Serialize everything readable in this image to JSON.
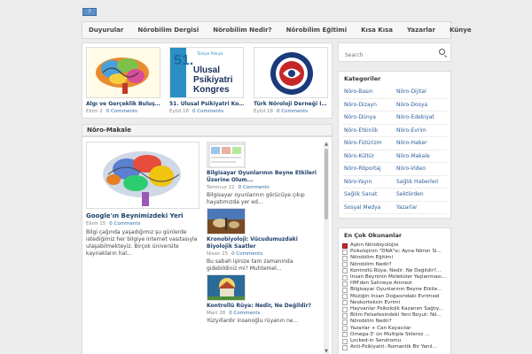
{
  "colors": {
    "accent": "#1d3f6a",
    "link": "#2e6aa8",
    "background": "#ececec"
  },
  "topbar": {
    "badge": "?"
  },
  "nav": [
    "Duyurular",
    "Nörobilim Dergisi",
    "Nörobilim Nedir?",
    "Nörobilim Eğitimi",
    "Kısa Kısa",
    "Yazarlar",
    "Künye"
  ],
  "featured": [
    {
      "title": "Algı ve Gerçeklik Buluşma...",
      "date": "Ekim 2",
      "comments": "0 Comments",
      "thumb_icon": "colorful-brain-image"
    },
    {
      "title": "51. Ulusal Psikiyatri Kon...",
      "date": "Eylül 18",
      "comments": "0 Comments",
      "thumb_text_small": "Türkiye Psikiya",
      "thumb_num": "51.",
      "thumb_line1": "Ulusal",
      "thumb_line2": "Psikiyatri",
      "thumb_line3": "Kongres"
    },
    {
      "title": "Türk Nöroloji Derneği İyi...",
      "date": "Eylül 18",
      "comments": "0 Comments",
      "thumb_icon": "neurology-society-logo"
    }
  ],
  "section_title": "Nöro-Makale",
  "big_post": {
    "title": "Google'ın Beynimizdeki Yeri",
    "date": "Ekim 15",
    "comments": "0 Comments",
    "excerpt": "Bilgi çağında yaşadığımız şu günlerde istediğimiz her bilgiye internet vasıtasıyla ulaşabilmekteyiz. Birçok üniversite kaynakların hal..."
  },
  "side_posts": [
    {
      "title": "Bilgisayar Oyunlarının Beyne Etkileri Üzerine Olum...",
      "date": "Temmuz 22",
      "comments": "0 Comments",
      "excerpt": "Bilgisayar oyunlarının görücüye çıkıp hayatımızda yer ed..."
    },
    {
      "title": "Kronobiyoloji: Vücudumuzdaki Biyolojik Saatler",
      "date": "Nisan 25",
      "comments": "0 Comments",
      "excerpt": "Bu sabah işinize tam zamanında gidebildiniz mi? Muhtemel..."
    },
    {
      "title": "Kontrollü Rüya: Nedir, Ne Değildir?",
      "date": "Mart 28",
      "comments": "0 Comments",
      "excerpt": "Yüzyıllardır insanoğlu rüyanın ne..."
    }
  ],
  "search": {
    "placeholder": "Search"
  },
  "categories": {
    "title": "Kategoriler",
    "items": [
      "Nöro-Basın",
      "Nöro-Dijital",
      "Nöro-Dizayn",
      "Nöro-Dosya",
      "Nöro-Dünya",
      "Nöro-Edebiyat",
      "Nöro-Etkinlik",
      "Nöro-Evrim",
      "Nöro-Fütürizm",
      "Nöro-Haber",
      "Nöro-Kültür",
      "Nöro-Makale",
      "Nöro-Röportaj",
      "Nöro-Video",
      "Nöro-Yayın",
      "Sağlık Haberleri",
      "Sağlık Sanat",
      "Sektörden",
      "Sosyal Medya",
      "Yazarlar"
    ]
  },
  "most_read": {
    "title": "En Çok Okunanlar",
    "items": [
      {
        "text": "Aşkın Nörobiyolojisi",
        "icon": "red"
      },
      {
        "text": "Psikolojinin \"DNA\"sı: Ayna Nöron Si...",
        "icon": "plain"
      },
      {
        "text": "Nörobilim Eğitimi",
        "icon": "plain"
      },
      {
        "text": "Nörobilim Nedir?",
        "icon": "plain"
      },
      {
        "text": "Kontrollü Rüya: Nedir, Ne Değildir?...",
        "icon": "plain"
      },
      {
        "text": "İnsan Beyninin Moleküler Yaşlanması...",
        "icon": "plain"
      },
      {
        "text": "HM'den Sahneye Amnezi",
        "icon": "plain"
      },
      {
        "text": "Bilgisayar Oyunlarının Beyne Etkile...",
        "icon": "plain"
      },
      {
        "text": "Müziğin İnsan Doğasındaki Evrimsel",
        "icon": "plain"
      },
      {
        "text": "Neokorteksin Evrimi",
        "icon": "plain"
      },
      {
        "text": "Hayvanlar Psikolojik Kazanım Sağlıy...",
        "icon": "plain"
      },
      {
        "text": "Bilim Felsefesindeki Yeni Boyut: Nö...",
        "icon": "plain"
      },
      {
        "text": "Nörobilim Nedir?",
        "icon": "plain"
      },
      {
        "text": "Yazarlar + Can Kayacılar",
        "icon": "plain"
      },
      {
        "text": "Omega-3' ün Multiple Skleroz ...",
        "icon": "plain"
      },
      {
        "text": "Locked-in Sendromu",
        "icon": "plain"
      },
      {
        "text": "Anti-Psikiyatri: Romantik Bir Yanıl...",
        "icon": "plain"
      }
    ]
  }
}
